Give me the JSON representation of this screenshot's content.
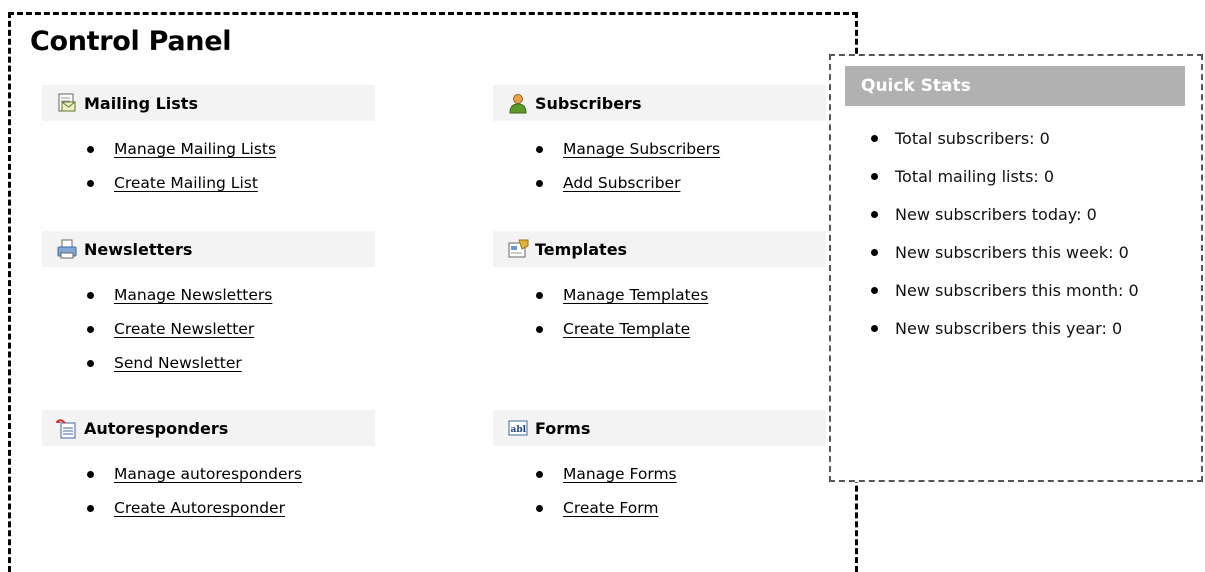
{
  "title": "Control Panel",
  "sections": {
    "mailing_lists": {
      "label": "Mailing Lists",
      "icon": "envelope-document-icon",
      "links": [
        "Manage Mailing Lists",
        "Create Mailing List"
      ]
    },
    "subscribers": {
      "label": "Subscribers",
      "icon": "person-icon",
      "links": [
        "Manage Subscribers",
        "Add Subscriber"
      ]
    },
    "newsletters": {
      "label": "Newsletters",
      "icon": "printer-icon",
      "links": [
        "Manage Newsletters",
        "Create Newsletter",
        "Send Newsletter"
      ]
    },
    "templates": {
      "label": "Templates",
      "icon": "template-icon",
      "links": [
        "Manage Templates",
        "Create Template"
      ]
    },
    "autoresponders": {
      "label": "Autoresponders",
      "icon": "autoresponder-icon",
      "links": [
        "Manage autoresponders",
        "Create Autoresponder"
      ]
    },
    "forms": {
      "label": "Forms",
      "icon": "form-field-icon",
      "links": [
        "Manage Forms",
        "Create Form"
      ]
    }
  },
  "quick_stats": {
    "title": "Quick Stats",
    "items": [
      "Total subscribers: 0",
      "Total mailing lists: 0",
      "New subscribers today: 0",
      "New subscribers this week: 0",
      "New subscribers this month: 0",
      "New subscribers this year: 0"
    ]
  },
  "colors": {
    "section_header_bg": "#f3f3f3",
    "stats_header_bg": "#b1b1b1"
  }
}
